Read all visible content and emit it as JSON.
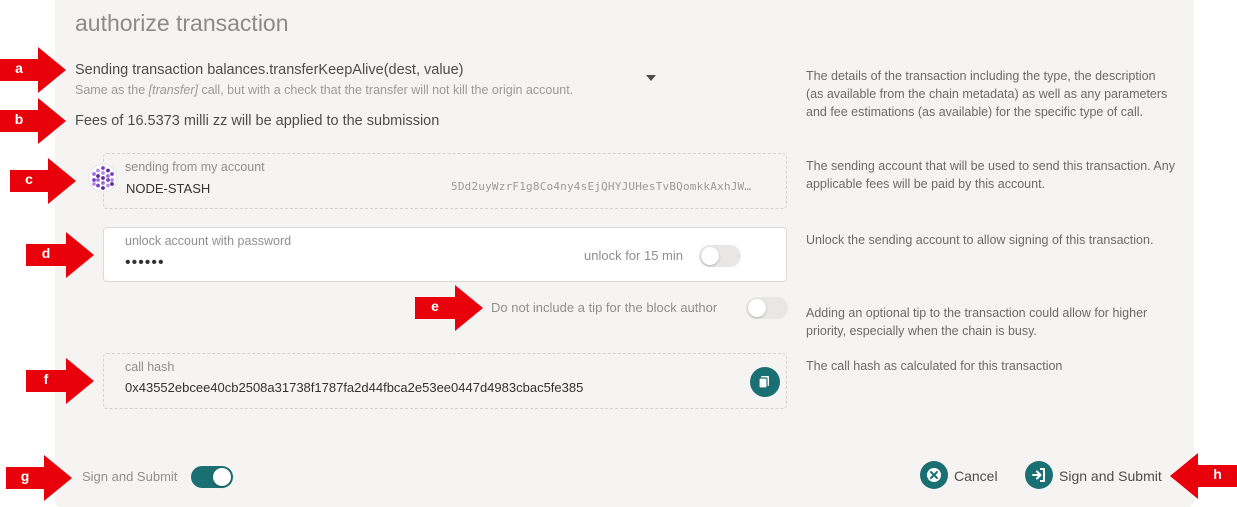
{
  "header": {
    "title": "authorize transaction"
  },
  "transaction": {
    "call": "Sending transaction balances.transferKeepAlive(dest, value)",
    "desc_pre": "Same as the ",
    "desc_tag": "[transfer]",
    "desc_post": " call, but with a check that the transfer will not kill the origin account.",
    "fees": "Fees of 16.5373 milli zz will be applied to the submission",
    "help": "The details of the transaction including the type, the description (as available from the chain metadata) as well as any parameters and fee estimations (as available) for the specific type of call."
  },
  "account": {
    "label": "sending from my account",
    "name": "NODE-STASH",
    "address": "5Dd2uyWzrF1g8Co4ny4sEjQHYJUHesTvBQomkkAxhJW…",
    "help": "The sending account that will be used to send this transaction. Any applicable fees will be paid by this account."
  },
  "unlock": {
    "label": "unlock account with password",
    "password": "••••••",
    "duration_label": "unlock for 15 min",
    "duration_on": false,
    "help": "Unlock the sending account to allow signing of this transaction."
  },
  "tip": {
    "label": "Do not include a tip for the block author",
    "on": false,
    "help": "Adding an optional tip to the transaction could allow for higher priority, especially when the chain is busy."
  },
  "call_hash": {
    "label": "call hash",
    "value": "0x43552ebcee40cb2508a31738f1787fa2d44fbca2e53ee0447d4983cbac5fe385",
    "help": "The call hash as calculated for this transaction"
  },
  "footer": {
    "sign_toggle_label": "Sign and Submit",
    "sign_toggle_on": true,
    "cancel_label": "Cancel",
    "submit_label": "Sign and Submit"
  },
  "annotations": [
    "a",
    "b",
    "c",
    "d",
    "e",
    "f",
    "g",
    "h"
  ],
  "colors": {
    "accent": "#1a6f73",
    "arrow": "#e8000b",
    "panel": "#f5f4f3"
  }
}
